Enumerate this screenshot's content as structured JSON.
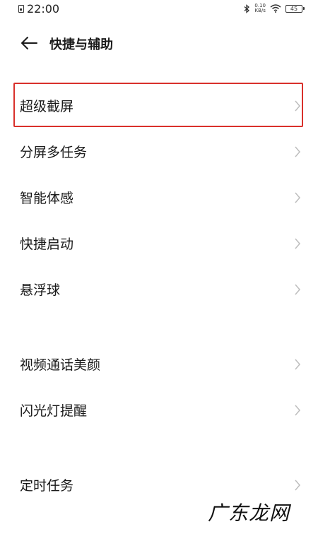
{
  "status_bar": {
    "time": "22:00",
    "speed_value": "0.10",
    "speed_unit": "KB/s",
    "battery": "45"
  },
  "header": {
    "title": "快捷与辅助"
  },
  "groups": [
    {
      "items": [
        {
          "label": "超级截屏"
        },
        {
          "label": "分屏多任务"
        },
        {
          "label": "智能体感"
        },
        {
          "label": "快捷启动"
        },
        {
          "label": "悬浮球"
        }
      ]
    },
    {
      "items": [
        {
          "label": "视频通话美颜"
        },
        {
          "label": "闪光灯提醒"
        }
      ]
    },
    {
      "items": [
        {
          "label": "定时任务"
        }
      ]
    }
  ],
  "watermark": "广东龙网",
  "colors": {
    "highlight": "#d9302b",
    "text": "#1a1a1a",
    "chevron": "#bdbdbd"
  }
}
